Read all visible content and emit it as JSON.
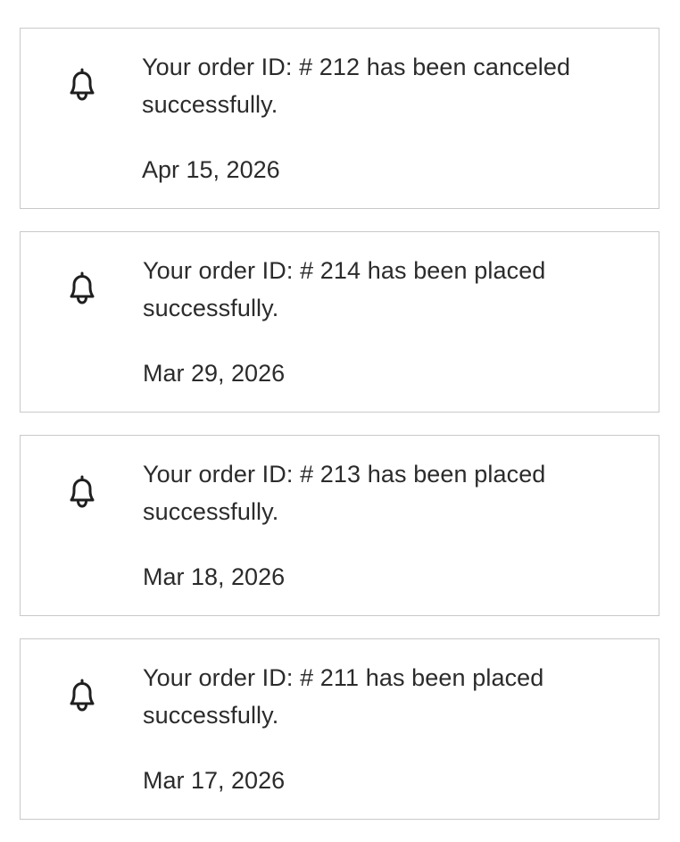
{
  "notifications": [
    {
      "message": "Your order ID: # 212 has been canceled successfully.",
      "date": "Apr 15, 2026",
      "icon": "bell-icon"
    },
    {
      "message": "Your order ID: # 214 has been placed successfully.",
      "date": "Mar 29, 2026",
      "icon": "bell-icon"
    },
    {
      "message": "Your order ID: # 213 has been placed successfully.",
      "date": "Mar 18, 2026",
      "icon": "bell-icon"
    },
    {
      "message": "Your order ID: # 211 has been placed successfully.",
      "date": "Mar 17, 2026",
      "icon": "bell-icon"
    }
  ]
}
